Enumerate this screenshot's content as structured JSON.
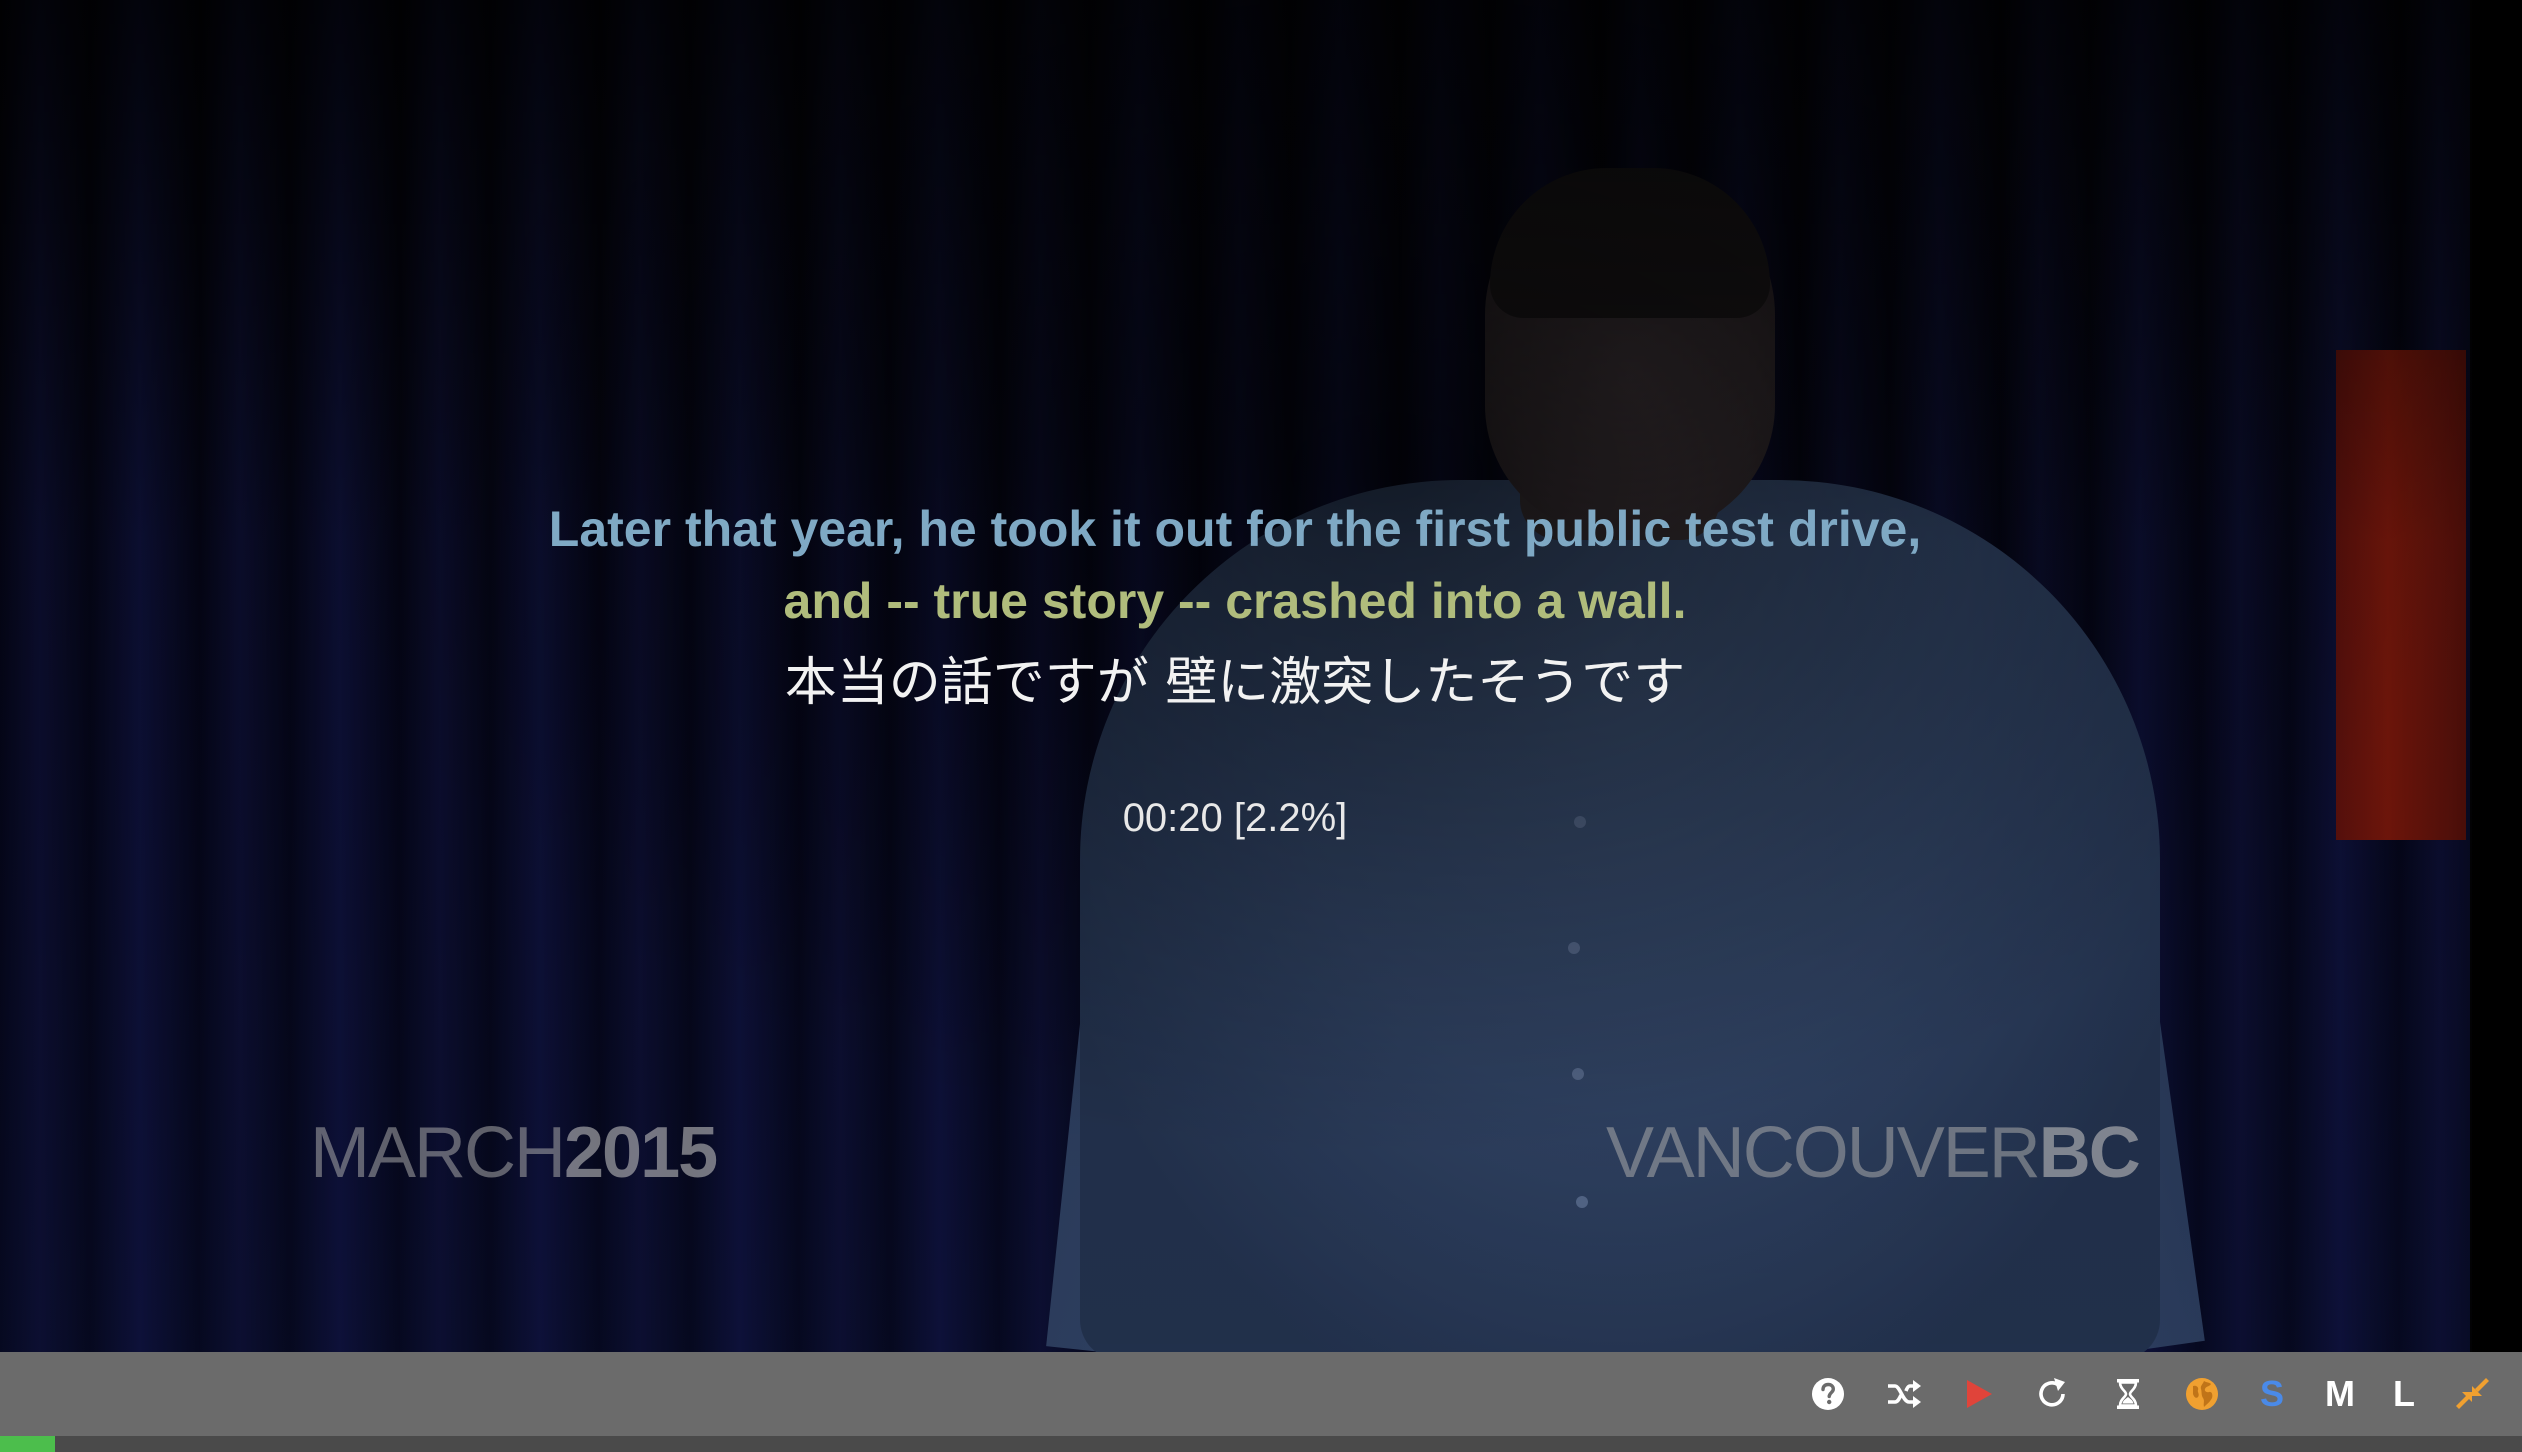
{
  "video": {
    "watermark_left_light": "MARCH",
    "watermark_left_bold": "2015",
    "watermark_right_light": "VANCOUVER",
    "watermark_right_bold": "BC"
  },
  "subtitles": {
    "line_1": "Later that year, he took it out for the first public test drive,",
    "line_2": "and -- true story -- crashed into a wall.",
    "line_3": "本当の話ですが 壁に激突したそうです",
    "line_1_color": "#7fa9c4",
    "line_2_color": "#b0bc7c",
    "line_3_color": "#f2f2f2"
  },
  "playback": {
    "timecode": "00:20 [2.2%]",
    "progress_fraction": 0.022
  },
  "controls": {
    "help_icon": "question-circle-icon",
    "shuffle_icon": "shuffle-icon",
    "play_icon": "play-icon",
    "repeat_icon": "reload-icon",
    "timer_icon": "hourglass-icon",
    "language_icon": "globe-icon",
    "size_small_label": "S",
    "size_medium_label": "M",
    "size_large_label": "L",
    "collapse_icon": "compress-icon",
    "play_color": "#e0443a",
    "globe_color": "#f0a030",
    "size_small_color": "#4a8ae8",
    "collapse_color": "#f0a030",
    "progress_color": "#4cbe4c"
  }
}
